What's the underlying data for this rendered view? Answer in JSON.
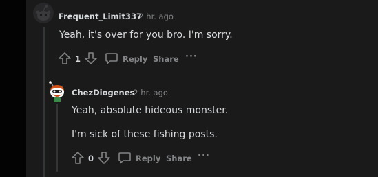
{
  "comments": [
    {
      "username": "Frequent_Limit337",
      "time": "· 2 hr. ago",
      "paragraphs": [
        "Yeah, it's over for you bro. I'm sorry."
      ],
      "votes": "1",
      "reply_label": "Reply",
      "share_label": "Share",
      "more_label": "···"
    },
    {
      "username": "ChezDiogenes",
      "time": "· 2 hr. ago",
      "paragraphs": [
        "Yeah, absolute hideous monster.",
        "I'm sick of these fishing posts."
      ],
      "votes": "0",
      "reply_label": "Reply",
      "share_label": "Share",
      "more_label": "···"
    }
  ],
  "colors": {
    "background": "#1a1a1b",
    "page": "#030303",
    "text": "#d7dadc",
    "muted": "#818384",
    "thread_line": "#343536"
  }
}
